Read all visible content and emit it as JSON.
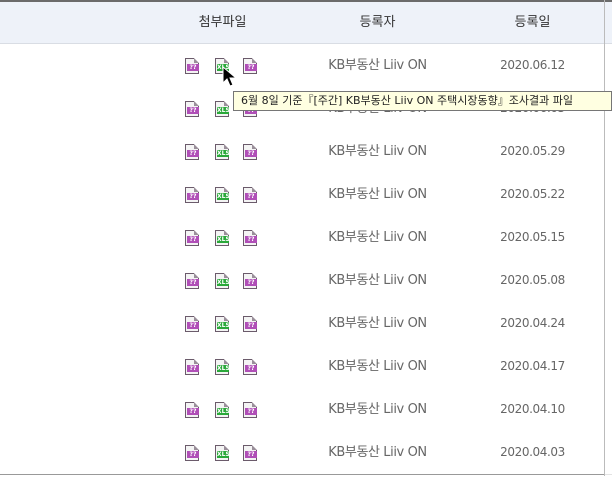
{
  "header": {
    "files_label": "첨부파일",
    "registrant_label": "등록자",
    "date_label": "등록일"
  },
  "file_badges": {
    "pdf": "??",
    "xls": "XLS",
    "hwp": "??"
  },
  "rows": [
    {
      "registrant": "KB부동산 Liiv ON",
      "date": "2020.06.12"
    },
    {
      "registrant": "KB부동산 Liiv ON",
      "date": "2020.06.05"
    },
    {
      "registrant": "KB부동산 Liiv ON",
      "date": "2020.05.29"
    },
    {
      "registrant": "KB부동산 Liiv ON",
      "date": "2020.05.22"
    },
    {
      "registrant": "KB부동산 Liiv ON",
      "date": "2020.05.15"
    },
    {
      "registrant": "KB부동산 Liiv ON",
      "date": "2020.05.08"
    },
    {
      "registrant": "KB부동산 Liiv ON",
      "date": "2020.04.24"
    },
    {
      "registrant": "KB부동산 Liiv ON",
      "date": "2020.04.17"
    },
    {
      "registrant": "KB부동산 Liiv ON",
      "date": "2020.04.10"
    },
    {
      "registrant": "KB부동산 Liiv ON",
      "date": "2020.04.03"
    }
  ],
  "tooltip": {
    "text": "6월 8일 기준『[주간] KB부동산 Liiv ON 주택시장동향』조사결과 파일"
  },
  "colors": {
    "header_bg": "#eef2f9",
    "xls_badge": "#2aa83a",
    "doc_badge": "#b04fb7",
    "tooltip_bg": "#ffffe1"
  }
}
